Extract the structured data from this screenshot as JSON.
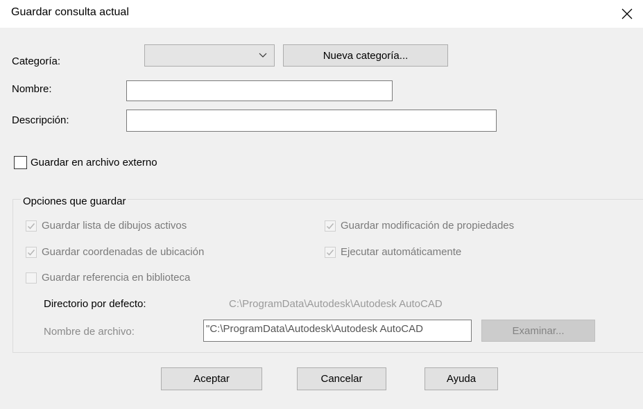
{
  "window": {
    "title": "Guardar consulta actual"
  },
  "fields": {
    "categoria_label": "Categoría:",
    "categoria_value": "",
    "nueva_categoria_button": "Nueva categoría...",
    "nombre_label": "Nombre:",
    "nombre_value": "",
    "descripcion_label": "Descripción:",
    "descripcion_value": ""
  },
  "external": {
    "label": "Guardar en archivo externo",
    "checked": false
  },
  "options": {
    "group_title": "Opciones que guardar",
    "items": [
      {
        "label": "Guardar lista de dibujos activos",
        "checked": true,
        "enabled": false
      },
      {
        "label": "Guardar modificación de propiedades",
        "checked": true,
        "enabled": false
      },
      {
        "label": "Guardar coordenadas de ubicación",
        "checked": true,
        "enabled": false
      },
      {
        "label": "Ejecutar automáticamente",
        "checked": true,
        "enabled": false
      },
      {
        "label": "Guardar referencia en biblioteca",
        "checked": false,
        "enabled": false
      }
    ],
    "default_dir_label": "Directorio por defecto:",
    "default_dir_value": "C:\\ProgramData\\Autodesk\\Autodesk AutoCAD",
    "file_name_label": "Nombre de archivo:",
    "file_name_value": "\"C:\\ProgramData\\Autodesk\\Autodesk AutoCAD",
    "browse_button": "Examinar..."
  },
  "buttons": {
    "ok": "Aceptar",
    "cancel": "Cancelar",
    "help": "Ayuda"
  },
  "icons": {
    "close": "close-icon",
    "dropdown": "chevron-down-icon",
    "check": "checkmark-icon"
  },
  "colors": {
    "background": "#f0f0f0",
    "titlebar": "#ffffff",
    "disabled_text": "#7a7a7a"
  }
}
